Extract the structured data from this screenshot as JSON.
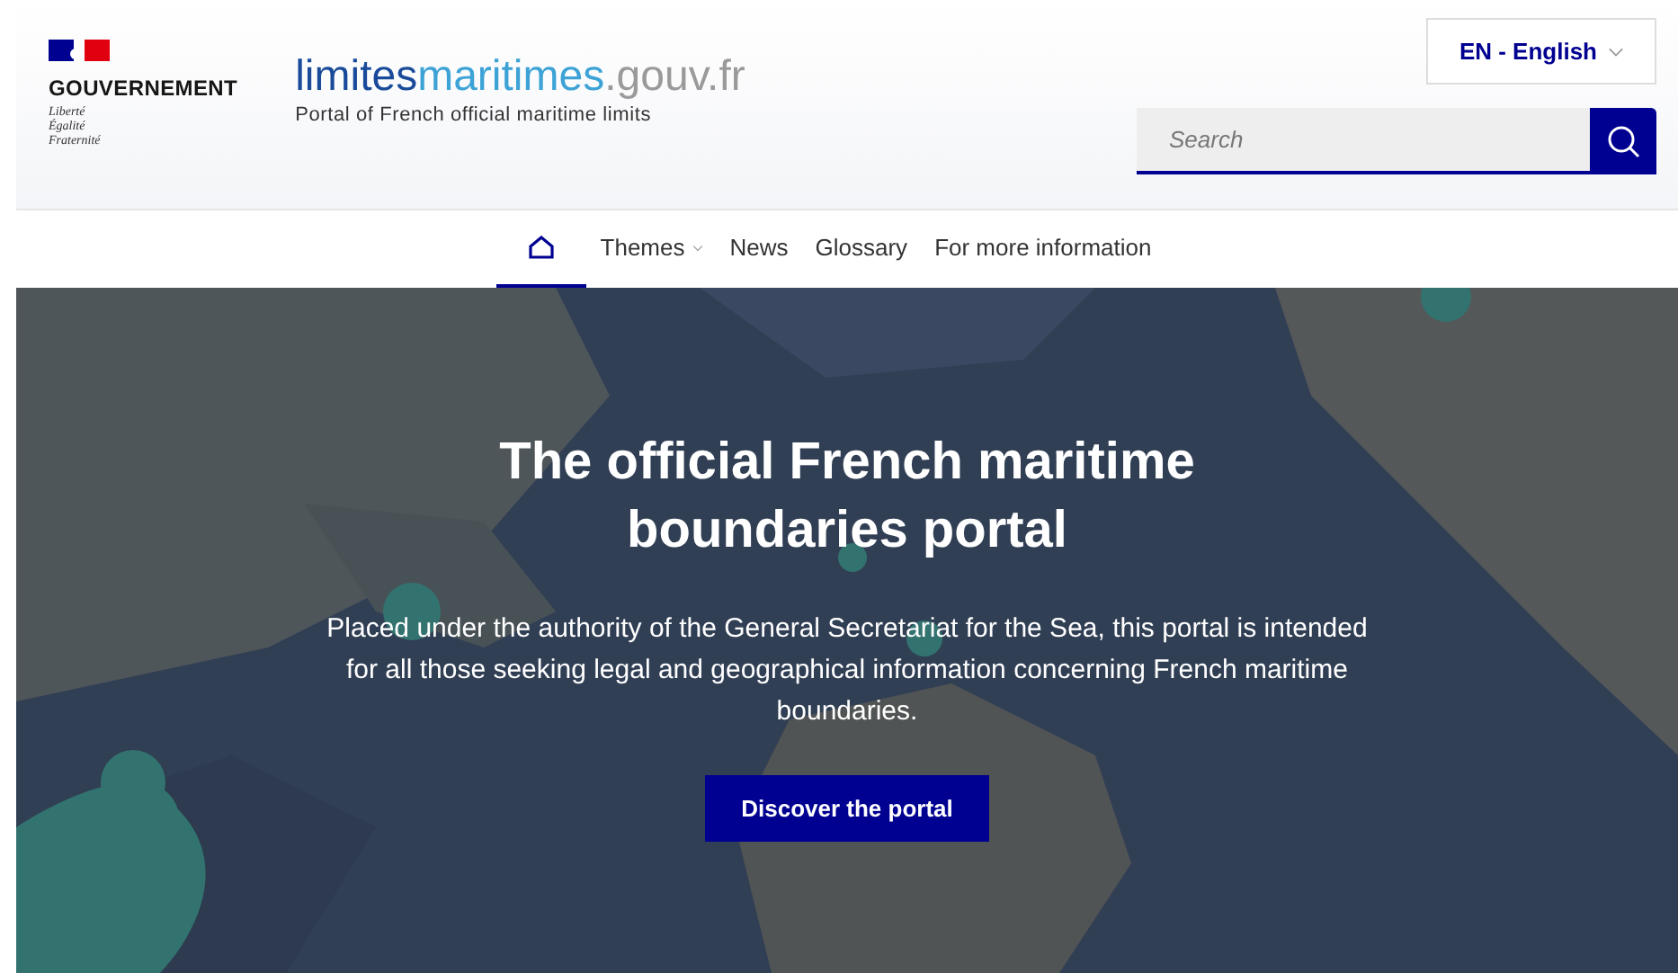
{
  "gov_logo": {
    "name": "GOUVERNEMENT",
    "motto": [
      "Liberté",
      "Égalité",
      "Fraternité"
    ]
  },
  "site_logo": {
    "first": "limites",
    "second": "maritimes",
    "domain": ".gouv.fr",
    "tagline": "Portal of French official maritime limits"
  },
  "language": {
    "label": "EN - English"
  },
  "search": {
    "placeholder": "Search"
  },
  "nav": [
    {
      "kind": "home",
      "selected": true
    },
    {
      "kind": "link",
      "label": "Themes",
      "dropdown": true,
      "selected": false
    },
    {
      "kind": "link",
      "label": "News",
      "dropdown": false,
      "selected": false
    },
    {
      "kind": "link",
      "label": "Glossary",
      "dropdown": false,
      "selected": false
    },
    {
      "kind": "link",
      "label": "For more information",
      "dropdown": false,
      "selected": false
    }
  ],
  "hero": {
    "kind": "picture",
    "title": "The official French maritime boundaries portal",
    "text": "Placed under the authority of the General Secretariat for the Sea, this portal is intended for all those seeking legal and geographical information concerning French maritime boundaries.",
    "button": "Discover the portal"
  }
}
